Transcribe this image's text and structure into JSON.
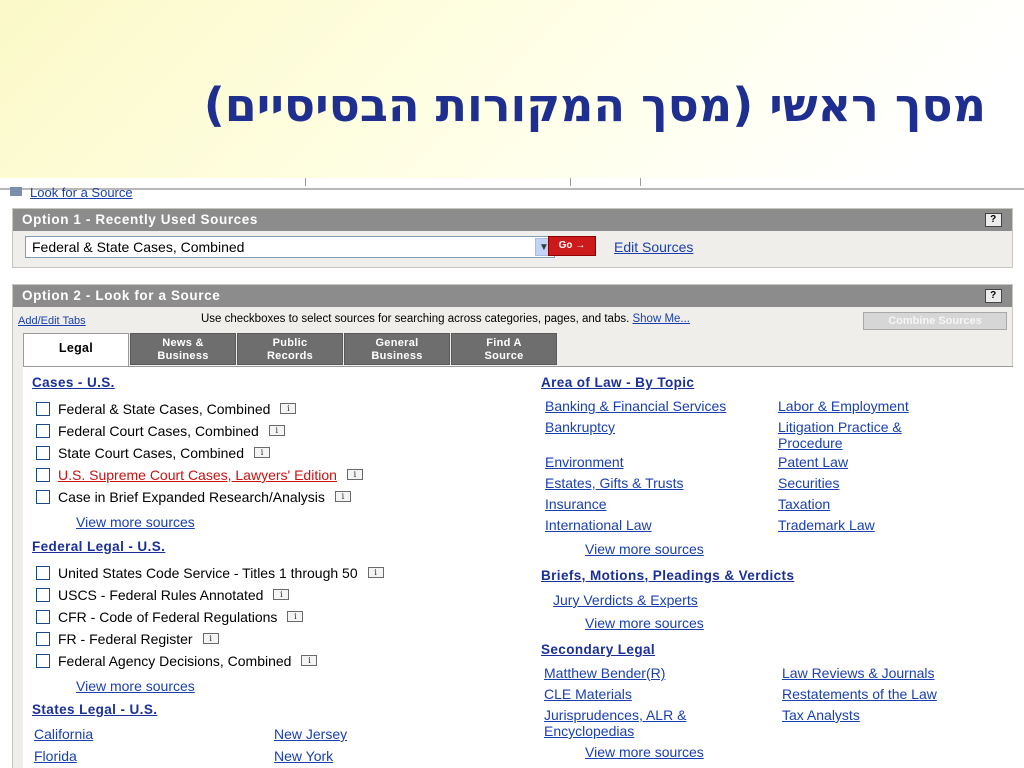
{
  "slide": {
    "title": "מסך ראשי (מסך המקורות הבסיסיים)"
  },
  "toolbar": {
    "look_for_source": "Look for a Source"
  },
  "option1": {
    "header": "Option 1 - Recently Used Sources",
    "help": "?",
    "selected_source": "Federal & State Cases, Combined",
    "go_label": "Go",
    "edit_sources": "Edit Sources"
  },
  "option2": {
    "header": "Option 2 - Look for a Source",
    "help": "?",
    "add_edit_tabs": "Add/Edit Tabs",
    "instructions": "Use checkboxes to select sources for searching across categories, pages, and tabs.",
    "show_me": "Show Me...",
    "combine_sources": "Combine Sources",
    "tabs": [
      {
        "line1": "Legal",
        "line2": ""
      },
      {
        "line1": "News &",
        "line2": "Business"
      },
      {
        "line1": "Public",
        "line2": "Records"
      },
      {
        "line1": "General",
        "line2": "Business"
      },
      {
        "line1": "Find A",
        "line2": "Source"
      }
    ]
  },
  "cases_us": {
    "title": "Cases - U.S.",
    "items": [
      "Federal & State Cases, Combined",
      "Federal Court Cases, Combined",
      "State Court Cases, Combined",
      "U.S. Supreme Court Cases, Lawyers' Edition",
      "Case in Brief Expanded Research/Analysis"
    ],
    "more": "View more sources"
  },
  "federal_legal": {
    "title": "Federal Legal - U.S.",
    "items": [
      "United States Code Service - Titles 1 through 50",
      "USCS - Federal Rules Annotated",
      "CFR - Code of Federal Regulations",
      "FR - Federal Register",
      "Federal Agency Decisions, Combined"
    ],
    "more": "View more sources"
  },
  "states_legal": {
    "title": "States Legal - U.S.",
    "col1": [
      "California",
      "Florida"
    ],
    "col2": [
      "New Jersey",
      "New York"
    ]
  },
  "area_of_law": {
    "title": "Area of Law - By Topic",
    "col1": [
      "Banking & Financial Services",
      "Bankruptcy",
      "Environment",
      "Estates, Gifts & Trusts",
      "Insurance",
      "International Law"
    ],
    "col2": [
      "Labor & Employment",
      "Litigation Practice &",
      "Procedure",
      "Patent Law",
      "Securities",
      "Taxation",
      "Trademark Law"
    ],
    "more": "View more sources"
  },
  "briefs": {
    "title": "Briefs, Motions, Pleadings & Verdicts",
    "items": [
      "Jury Verdicts & Experts"
    ],
    "more": "View more sources"
  },
  "secondary": {
    "title": "Secondary Legal",
    "col1": [
      "Matthew Bender(R)",
      "CLE Materials",
      "Jurisprudences, ALR &",
      "Encyclopedias"
    ],
    "col2": [
      "Law Reviews & Journals",
      "Restatements of the Law",
      "Tax Analysts"
    ],
    "more": "View more sources"
  },
  "icons": {
    "info": "i",
    "dropdown": "▼",
    "go_arrow": "→"
  }
}
